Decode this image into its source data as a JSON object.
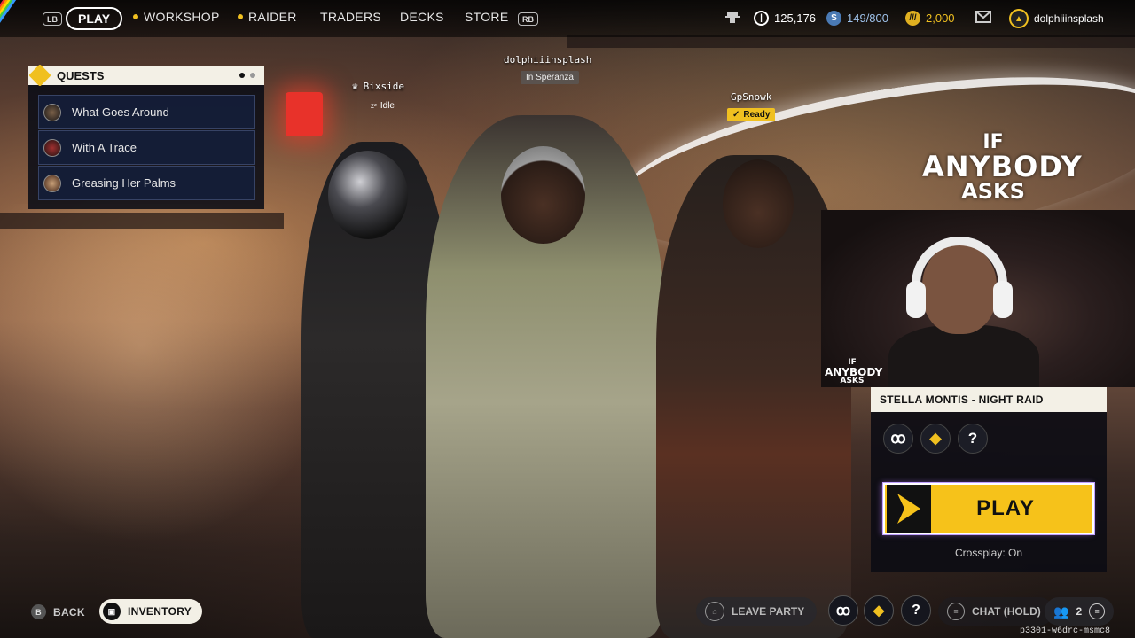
{
  "topbar": {
    "left_bumper": "LB",
    "right_bumper": "RB",
    "nav": [
      {
        "label": "PLAY",
        "active": true
      },
      {
        "label": "WORKSHOP",
        "dot": true
      },
      {
        "label": "RAIDER",
        "dot": true
      },
      {
        "label": "TRADERS"
      },
      {
        "label": "DECKS"
      },
      {
        "label": "STORE"
      }
    ],
    "stats": {
      "coins": "125,176",
      "stash": "149/800",
      "raider_tokens": "2,000"
    },
    "username": "dolphiiinsplash"
  },
  "quests": {
    "title": "QUESTS",
    "items": [
      {
        "label": "What Goes Around"
      },
      {
        "label": "With A Trace"
      },
      {
        "label": "Greasing Her Palms"
      }
    ]
  },
  "party": {
    "players": [
      {
        "name": "dolphiiinsplash",
        "status": "In Speranza"
      },
      {
        "name": "Bixside",
        "status": "Idle"
      },
      {
        "name": "GpSnowk",
        "status": "Ready"
      }
    ]
  },
  "stream_overlay": {
    "line1": "IF",
    "line2": "ANYBODY",
    "line3": "ASKS",
    "cam_logo_line1": "IF",
    "cam_logo_line2": "ANYBODY",
    "cam_logo_line3": "ASKS"
  },
  "match": {
    "map_title": "STELLA MONTIS - NIGHT RAID",
    "play_label": "PLAY",
    "crossplay": "Crossplay: On"
  },
  "bottom": {
    "back_key": "B",
    "back_label": "BACK",
    "inventory_label": "INVENTORY",
    "leave_party_label": "LEAVE PARTY",
    "chat_label": "CHAT (HOLD)",
    "party_count": "2",
    "session_id": "p3301-w6drc-msmc8"
  },
  "colors": {
    "accent_yellow": "#f6c21a",
    "panel_cream": "#f3f0e6",
    "ready_badge": "#f0c020"
  }
}
